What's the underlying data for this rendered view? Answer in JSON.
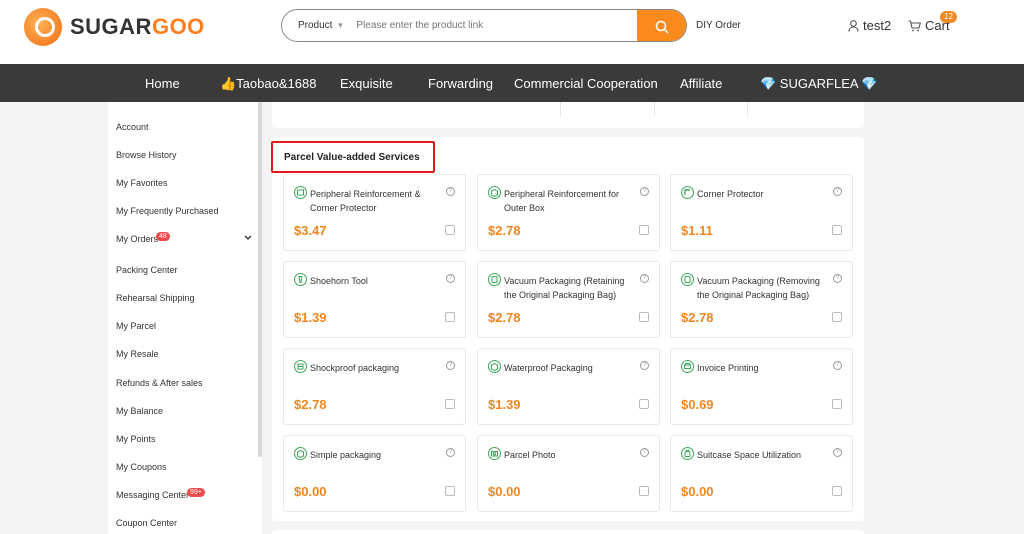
{
  "brand": {
    "name_part1": "SUGAR",
    "name_part2": "GOO",
    "accent": "#fa8a1c"
  },
  "search": {
    "type_label": "Product",
    "placeholder": "Please enter the product link"
  },
  "header": {
    "diy_order": "DIY Order",
    "username": "test2",
    "cart_label": "Cart",
    "cart_count": "12"
  },
  "nav": {
    "items": [
      {
        "label": "Home"
      },
      {
        "label": "👍Taobao&1688"
      },
      {
        "label": "Exquisite"
      },
      {
        "label": "Forwarding"
      },
      {
        "label": "Commercial Cooperation"
      },
      {
        "label": "Affiliate"
      },
      {
        "label": "💎 SUGARFLEA 💎"
      }
    ]
  },
  "sidebar": {
    "items": [
      {
        "label": "Account"
      },
      {
        "label": "Browse History"
      },
      {
        "label": "My Favorites"
      },
      {
        "label": "My Frequently Purchased"
      },
      {
        "label": "My Orders",
        "badge": "48"
      },
      {
        "label": "Packing Center"
      },
      {
        "label": "Rehearsal Shipping"
      },
      {
        "label": "My Parcel"
      },
      {
        "label": "My Resale"
      },
      {
        "label": "Refunds & After sales"
      },
      {
        "label": "My Balance"
      },
      {
        "label": "My Points"
      },
      {
        "label": "My Coupons"
      },
      {
        "label": "Messaging Center",
        "badge": "99+"
      },
      {
        "label": "Coupon Center"
      }
    ]
  },
  "section": {
    "title": "Parcel Value-added Services"
  },
  "services": [
    {
      "name": "Peripheral Reinforcement & Corner Protector",
      "price": "$3.47"
    },
    {
      "name": "Peripheral Reinforcement for Outer Box",
      "price": "$2.78"
    },
    {
      "name": "Corner Protector",
      "price": "$1.11"
    },
    {
      "name": "Shoehorn Tool",
      "price": "$1.39"
    },
    {
      "name": "Vacuum Packaging (Retaining the Original Packaging Bag)",
      "price": "$2.78"
    },
    {
      "name": "Vacuum Packaging (Removing the Original Packaging Bag)",
      "price": "$2.78"
    },
    {
      "name": "Shockproof packaging",
      "price": "$2.78"
    },
    {
      "name": "Waterproof Packaging",
      "price": "$1.39"
    },
    {
      "name": "Invoice Printing",
      "price": "$0.69"
    },
    {
      "name": "Simple packaging",
      "price": "$0.00"
    },
    {
      "name": "Parcel Photo",
      "price": "$0.00"
    },
    {
      "name": "Suitcase Space Utilization",
      "price": "$0.00"
    }
  ]
}
